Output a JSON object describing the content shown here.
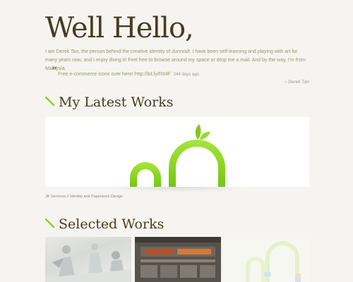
{
  "hero": {
    "title": "Well Hello,",
    "intro_before": "I am Derek Tan, the person behind the creative identity of ",
    "intro_brand": "dunnodt",
    "intro_after": ". I have been self-learning and playing with art for many years now, and I enjoy doing it! Feel free to browse around my space or drop me a mail. And by the way, I'm from Malaysia."
  },
  "tweet": {
    "text": "Free e-commerce icons over here! http://bit.ly/RIt4F",
    "ago": "244 days ago",
    "signature": "~ Derek Tan"
  },
  "latest": {
    "title": "My Latest Works",
    "caption": "JK Services // Identity and Paperwork Design"
  },
  "selected": {
    "title": "Selected Works"
  },
  "colors": {
    "heading": "#4b3a21",
    "accent_green": "#8fd11f",
    "body_text": "#8f9b68",
    "background": "#f5f4f0"
  }
}
